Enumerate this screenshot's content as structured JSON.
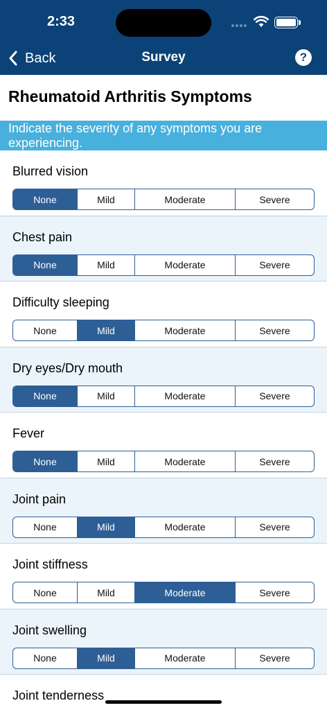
{
  "status_bar": {
    "time": "2:33"
  },
  "nav": {
    "back_label": "Back",
    "title": "Survey",
    "help_label": "?"
  },
  "page": {
    "title": "Rheumatoid Arthritis Symptoms",
    "instruction": "Indicate the severity of any symptoms you are experiencing."
  },
  "colors": {
    "nav_bar": "#0b4277",
    "instruction_bg": "#48b0dc",
    "selected": "#2e5e96",
    "alt_row": "#eaf4fa"
  },
  "options": [
    "None",
    "Mild",
    "Moderate",
    "Severe"
  ],
  "symptoms": [
    {
      "name": "Blurred vision",
      "selected": "None"
    },
    {
      "name": "Chest pain",
      "selected": "None"
    },
    {
      "name": "Difficulty sleeping",
      "selected": "Mild"
    },
    {
      "name": "Dry eyes/Dry mouth",
      "selected": "None"
    },
    {
      "name": "Fever",
      "selected": "None"
    },
    {
      "name": "Joint pain",
      "selected": "Mild"
    },
    {
      "name": "Joint stiffness",
      "selected": "Moderate"
    },
    {
      "name": "Joint swelling",
      "selected": "Mild"
    },
    {
      "name": "Joint tenderness",
      "selected": ""
    }
  ]
}
